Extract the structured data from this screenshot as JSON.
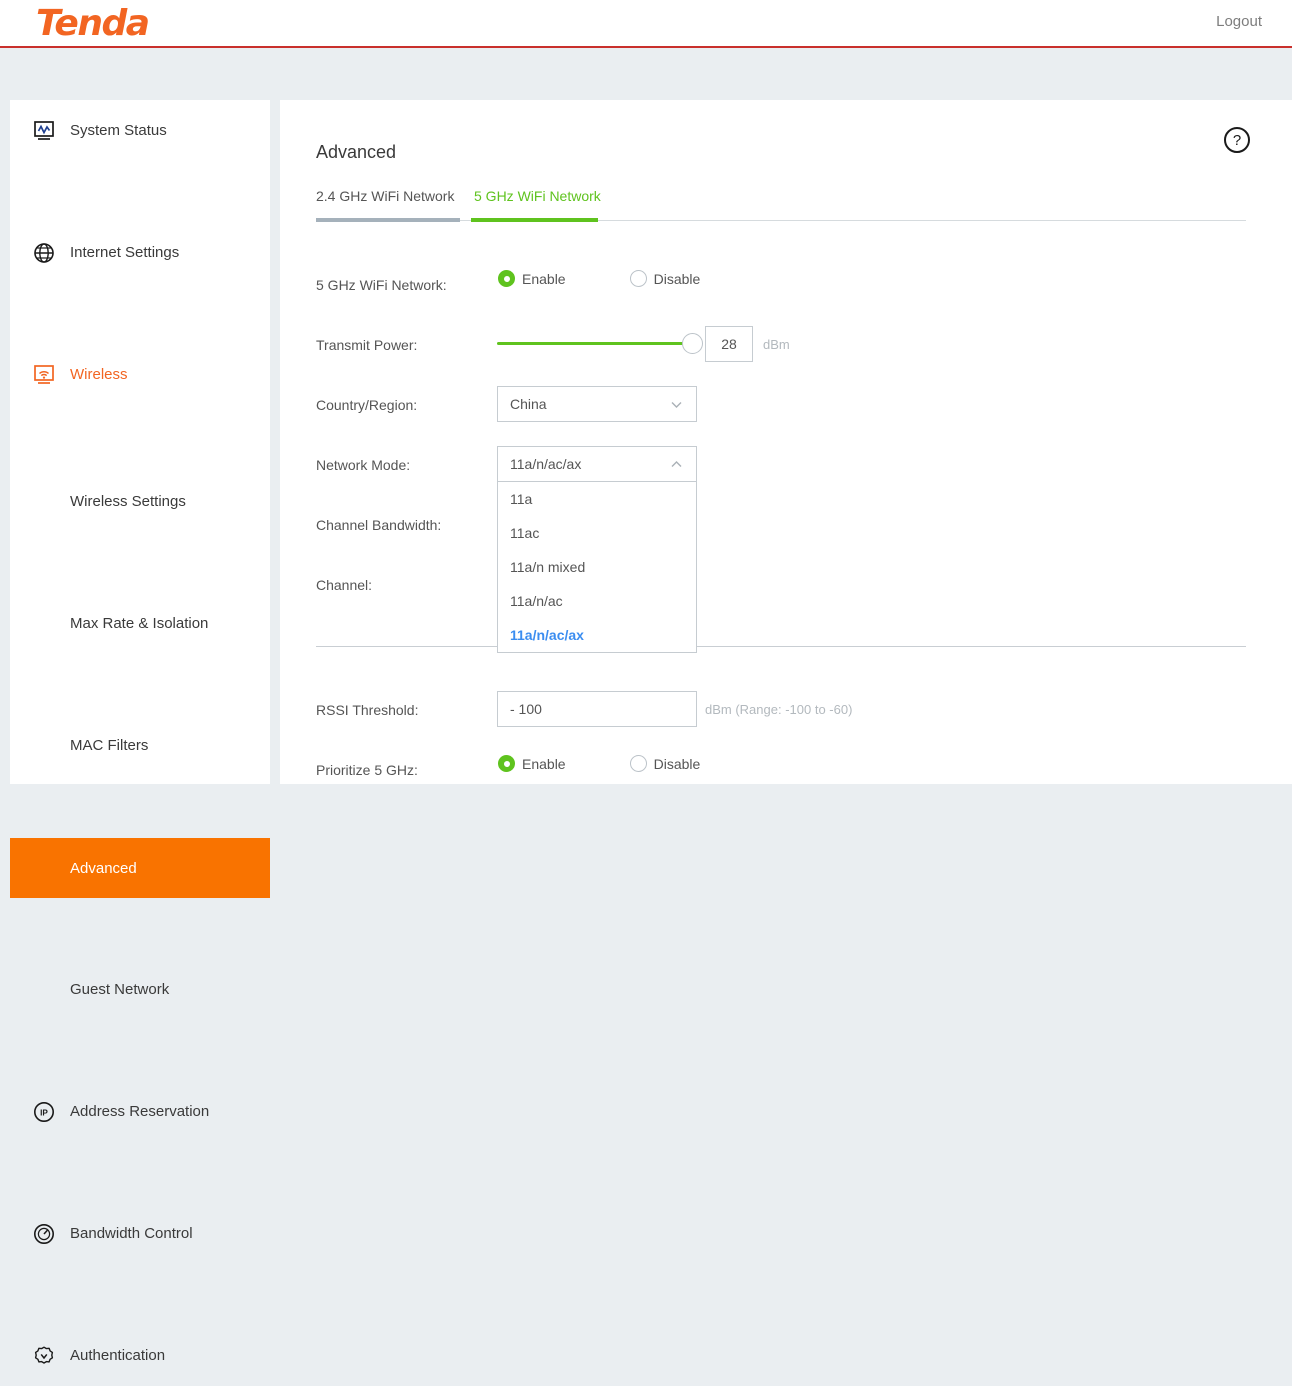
{
  "header": {
    "logo_text": "Tenda",
    "logout_label": "Logout",
    "brand_color": "#f26522",
    "accent_rule_color": "#c9302c"
  },
  "sidebar": {
    "items": [
      {
        "label": "System Status",
        "icon": "monitor-chart-icon",
        "type": "top",
        "state": "normal"
      },
      {
        "label": "Internet Settings",
        "icon": "globe-icon",
        "type": "top",
        "state": "normal"
      },
      {
        "label": "Wireless",
        "icon": "wifi-icon",
        "type": "top",
        "state": "expanded-active"
      },
      {
        "label": "Wireless Settings",
        "icon": "",
        "type": "sub",
        "state": "normal"
      },
      {
        "label": "Max Rate & Isolation",
        "icon": "",
        "type": "sub",
        "state": "normal"
      },
      {
        "label": "MAC Filters",
        "icon": "",
        "type": "sub",
        "state": "normal"
      },
      {
        "label": "Advanced",
        "icon": "",
        "type": "sub",
        "state": "selected"
      },
      {
        "label": "Guest Network",
        "icon": "",
        "type": "sub",
        "state": "normal"
      },
      {
        "label": "Address Reservation",
        "icon": "ip-badge-icon",
        "type": "top",
        "state": "normal"
      },
      {
        "label": "Bandwidth Control",
        "icon": "gauge-icon",
        "type": "top",
        "state": "normal"
      },
      {
        "label": "Authentication",
        "icon": "verified-badge-icon",
        "type": "top",
        "state": "normal"
      }
    ],
    "selected_color": "#f97300",
    "active_text_color": "#f26522"
  },
  "main": {
    "title": "Advanced",
    "help_icon": "question-mark-icon",
    "tabs": [
      {
        "label": "2.4 GHz WiFi Network",
        "active": false
      },
      {
        "label": "5 GHz WiFi Network",
        "active": true
      }
    ],
    "active_tab_color": "#5fc31e",
    "inactive_tab_underline_color": "#a5b1bb"
  },
  "form": {
    "wifi_network": {
      "label": "5 GHz WiFi Network:",
      "enable_label": "Enable",
      "disable_label": "Disable",
      "selected": "Enable"
    },
    "transmit_power": {
      "label": "Transmit Power:",
      "value": "28",
      "unit": "dBm",
      "slider_percent": 96
    },
    "country_region": {
      "label": "Country/Region:",
      "value": "China",
      "chevron": "chevron-down-icon"
    },
    "network_mode": {
      "label": "Network Mode:",
      "value": "11a/n/ac/ax",
      "chevron": "chevron-up-icon",
      "open": true,
      "options": [
        {
          "label": "11a",
          "selected": false
        },
        {
          "label": "11ac",
          "selected": false
        },
        {
          "label": "11a/n mixed",
          "selected": false
        },
        {
          "label": "11a/n/ac",
          "selected": false
        },
        {
          "label": "11a/n/ac/ax",
          "selected": true
        }
      ],
      "selected_option_color": "#3b8df0"
    },
    "channel_bandwidth": {
      "label": "Channel Bandwidth:"
    },
    "channel": {
      "label": "Channel:"
    },
    "rssi_threshold": {
      "label": "RSSI Threshold:",
      "value": "- 100",
      "hint": "dBm (Range: -100 to -60)"
    },
    "prioritize_5ghz": {
      "label": "Prioritize 5 GHz:",
      "enable_label": "Enable",
      "disable_label": "Disable",
      "selected": "Enable"
    }
  }
}
